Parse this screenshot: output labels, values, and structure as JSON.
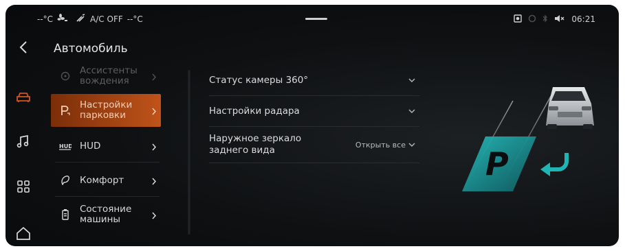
{
  "status_bar": {
    "temp_left": "--°C",
    "fan_icon": "fan-icon",
    "ac_icon": "ac-icon",
    "ac_status": "A/C OFF",
    "temp_right": "--°C",
    "time": "06:21",
    "mute_icon": "mute-icon"
  },
  "rail": {
    "items": [
      "back-icon",
      "car-icon",
      "music-icon",
      "apps-icon",
      "home-icon"
    ]
  },
  "panel": {
    "title": "Автомобиль",
    "items": [
      {
        "label": "Ассистенты\nвождения",
        "icon": "steering-icon"
      },
      {
        "label": "Настройки\nпарковки",
        "icon": "parking-icon"
      },
      {
        "label": "HUD",
        "icon": "hud-icon"
      },
      {
        "label": "Комфорт",
        "icon": "comfort-icon"
      },
      {
        "label": "Состояние\nмашины",
        "icon": "battery-icon"
      }
    ]
  },
  "settings": {
    "rows": [
      {
        "label": "Статус камеры 360°",
        "value": ""
      },
      {
        "label": "Настройки радара",
        "value": ""
      },
      {
        "label": "Наружное зеркало\nзаднего вида",
        "value": "Открыть все"
      }
    ]
  },
  "illustration": {
    "parking_letter": "P",
    "accent_color": "#1fb5b5",
    "highlight_color": "#c0531a"
  }
}
